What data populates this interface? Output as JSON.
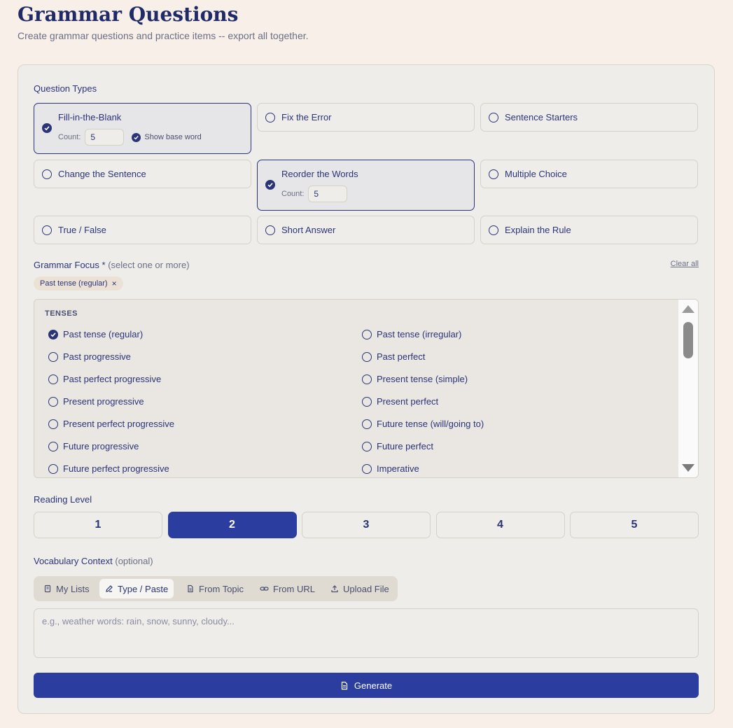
{
  "header": {
    "title": "Grammar Questions",
    "subtitle": "Create grammar questions and practice items -- export all together."
  },
  "question_types": {
    "label": "Question Types",
    "items": [
      {
        "label": "Fill-in-the-Blank",
        "selected": true,
        "count_label": "Count:",
        "count": "5",
        "show_base_word": "Show base word"
      },
      {
        "label": "Fix the Error",
        "selected": false
      },
      {
        "label": "Sentence Starters",
        "selected": false
      },
      {
        "label": "Change the Sentence",
        "selected": false
      },
      {
        "label": "Reorder the Words",
        "selected": true,
        "count_label": "Count:",
        "count": "5"
      },
      {
        "label": "Multiple Choice",
        "selected": false
      },
      {
        "label": "True / False",
        "selected": false
      },
      {
        "label": "Short Answer",
        "selected": false
      },
      {
        "label": "Explain the Rule",
        "selected": false
      }
    ]
  },
  "grammar_focus": {
    "label": "Grammar Focus *",
    "hint": "(select one or more)",
    "clear_all": "Clear all",
    "chips": [
      {
        "label": "Past tense (regular)",
        "remove": "×"
      }
    ],
    "category": "TENSES",
    "options": [
      {
        "label": "Past tense (regular)",
        "checked": true
      },
      {
        "label": "Past tense (irregular)",
        "checked": false
      },
      {
        "label": "Past progressive",
        "checked": false
      },
      {
        "label": "Past perfect",
        "checked": false
      },
      {
        "label": "Past perfect progressive",
        "checked": false
      },
      {
        "label": "Present tense (simple)",
        "checked": false
      },
      {
        "label": "Present progressive",
        "checked": false
      },
      {
        "label": "Present perfect",
        "checked": false
      },
      {
        "label": "Present perfect progressive",
        "checked": false
      },
      {
        "label": "Future tense (will/going to)",
        "checked": false
      },
      {
        "label": "Future progressive",
        "checked": false
      },
      {
        "label": "Future perfect",
        "checked": false
      },
      {
        "label": "Future perfect progressive",
        "checked": false
      },
      {
        "label": "Imperative",
        "checked": false
      }
    ]
  },
  "reading_level": {
    "label": "Reading Level",
    "levels": [
      "1",
      "2",
      "3",
      "4",
      "5"
    ],
    "selected": "2"
  },
  "vocabulary": {
    "label": "Vocabulary Context",
    "hint": "(optional)",
    "tabs": [
      {
        "label": "My Lists",
        "icon": "bookmark-icon"
      },
      {
        "label": "Type / Paste",
        "icon": "pencil-icon",
        "active": true
      },
      {
        "label": "From Topic",
        "icon": "document-icon"
      },
      {
        "label": "From URL",
        "icon": "link-icon"
      },
      {
        "label": "Upload File",
        "icon": "upload-icon"
      }
    ],
    "placeholder": "e.g., weather words: rain, snow, sunny, cloudy..."
  },
  "actions": {
    "generate_label": "Generate"
  },
  "colors": {
    "accent": "#2b3ea0",
    "text": "#2b3478",
    "background": "#f7efe8"
  }
}
